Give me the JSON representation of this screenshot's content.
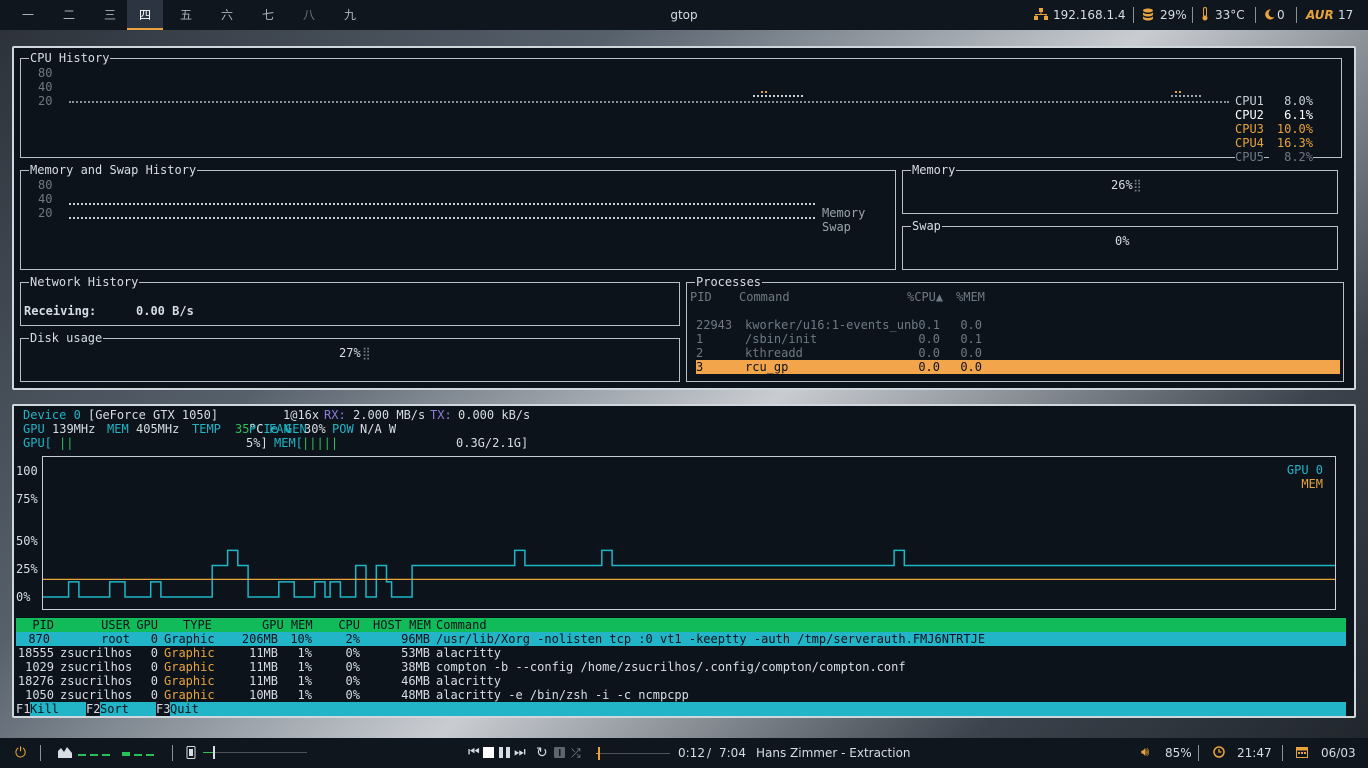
{
  "topbar": {
    "workspaces": [
      "一",
      "二",
      "三",
      "四",
      "五",
      "六",
      "七",
      "八",
      "九"
    ],
    "active_workspace": 3,
    "window_title": "gtop",
    "ip": "192.168.1.4",
    "disk": "29%",
    "temp": "33°C",
    "moon_count": "0",
    "aur_label": "AUR",
    "aur_count": "17"
  },
  "cpu": {
    "title": "CPU History",
    "ticks": [
      "80",
      "40",
      "20"
    ],
    "legend": [
      {
        "name": "CPU1",
        "value": "8.0%",
        "color": "#c9ced3"
      },
      {
        "name": "CPU2",
        "value": "6.1%",
        "color": "#ffffff"
      },
      {
        "name": "CPU3",
        "value": "10.0%",
        "color": "#e8a33d"
      },
      {
        "name": "CPU4",
        "value": "16.3%",
        "color": "#e8a33d"
      },
      {
        "name": "CPU5",
        "value": "8.2%",
        "color": "#6f7983"
      }
    ]
  },
  "memswap": {
    "title": "Memory and Swap History",
    "ticks": [
      "80",
      "40",
      "20"
    ],
    "legend": [
      "Memory",
      "Swap"
    ]
  },
  "memory": {
    "title": "Memory",
    "value": "26%"
  },
  "swap": {
    "title": "Swap",
    "value": "0%"
  },
  "network": {
    "title": "Network History",
    "label": "Receiving:",
    "value": "0.00 B/s"
  },
  "disk": {
    "title": "Disk usage",
    "value": "27%"
  },
  "processes": {
    "title": "Processes",
    "headers": {
      "pid": "PID",
      "command": "Command",
      "cpu": "%CPU▲",
      "mem": "%MEM"
    },
    "rows": [
      {
        "pid": "22943",
        "command": "kworker/u16:1-events_unb",
        "cpu": "0.1",
        "mem": "0.0"
      },
      {
        "pid": "1",
        "command": "/sbin/init",
        "cpu": "0.0",
        "mem": "0.1"
      },
      {
        "pid": "2",
        "command": "kthreadd",
        "cpu": "0.0",
        "mem": "0.0"
      },
      {
        "pid": "3",
        "command": "rcu_gp",
        "cpu": "0.0",
        "mem": "0.0"
      }
    ],
    "selected_index": 3
  },
  "nvtop": {
    "device_label": "Device 0",
    "device_name": "[GeForce GTX 1050]",
    "pcie_label": "PCIe GEN",
    "pcie_value": "1@16x",
    "rx_label": "RX:",
    "rx_value": "2.000 MB/s",
    "tx_label": "TX:",
    "tx_value": "0.000 kB/s",
    "gpu_label": "GPU",
    "gpu_clock": "139MHz",
    "mem_label": "MEM",
    "mem_clock": "405MHz",
    "temp_label": "TEMP",
    "temp_value": "35",
    "temp_unit": "°C",
    "fan_label": "FAN",
    "fan_value": "30%",
    "pow_label": "POW",
    "pow_value": "N/A W",
    "gpu_bar_label": "GPU[",
    "gpu_bar_fill": "||",
    "gpu_bar_value": "5%]",
    "mem_bar_label": "MEM[",
    "mem_bar_fill": "|||||",
    "mem_bar_value": "0.3G/2.1G]",
    "gpu_util_fraction": 0.05,
    "mem_used_fraction": 0.14
  },
  "chart_data": {
    "type": "line",
    "y_ticks": [
      "100",
      "75%",
      "50%",
      "25%",
      "0%"
    ],
    "ylim": [
      0,
      100
    ],
    "legend_position": "top-right",
    "series": [
      {
        "name": "GPU 0",
        "color": "#1fb6c8",
        "values": [
          0,
          0,
          0,
          0,
          0,
          12,
          12,
          0,
          0,
          0,
          0,
          0,
          0,
          12,
          12,
          12,
          0,
          0,
          0,
          0,
          0,
          12,
          12,
          0,
          0,
          0,
          0,
          0,
          0,
          0,
          0,
          0,
          0,
          25,
          25,
          25,
          37,
          37,
          25,
          25,
          0,
          0,
          0,
          0,
          0,
          0,
          12,
          12,
          12,
          0,
          0,
          0,
          0,
          12,
          12,
          0,
          12,
          12,
          0,
          0,
          0,
          25,
          25,
          0,
          0,
          25,
          25,
          12,
          0,
          0,
          0,
          0,
          25,
          25,
          25,
          25,
          25,
          25,
          25,
          25,
          25,
          25,
          25,
          25,
          25,
          25,
          25,
          25,
          25,
          25,
          25,
          25,
          37,
          37,
          25,
          25,
          25,
          25,
          25,
          25,
          25,
          25,
          25,
          25,
          25,
          25,
          25,
          25,
          25,
          37,
          37,
          25,
          25,
          25,
          25,
          25,
          25,
          25,
          25,
          25,
          25,
          25,
          25,
          25,
          25,
          25,
          25,
          25,
          25,
          25,
          25,
          25,
          25,
          25,
          25,
          25,
          25,
          25,
          25,
          25,
          25,
          25,
          25,
          25,
          25,
          25,
          25,
          25,
          25,
          25,
          25,
          25,
          25,
          25,
          25,
          25,
          25,
          25,
          25,
          25,
          25,
          25,
          25,
          25,
          25,
          25,
          37,
          37,
          25,
          25,
          25,
          25,
          25,
          25,
          25,
          25,
          25,
          25,
          25,
          25,
          25,
          25,
          25,
          25,
          25,
          25,
          25,
          25,
          25,
          25,
          25,
          25,
          25,
          25,
          25,
          25,
          25,
          25,
          25,
          25,
          25,
          25,
          25,
          25,
          25,
          25,
          25,
          25,
          25,
          25,
          25,
          25,
          25,
          25,
          25,
          25,
          25,
          25,
          25,
          25,
          25,
          25,
          25,
          25,
          25,
          25,
          25,
          25,
          25,
          25,
          25,
          25,
          25,
          25,
          25,
          25,
          25,
          25,
          25,
          25,
          25,
          25,
          25,
          25,
          25,
          25,
          25,
          25,
          25,
          25,
          25,
          25
        ]
      },
      {
        "name": "MEM",
        "color": "#e8a33d",
        "values": [
          14
        ]
      }
    ]
  },
  "gpu_processes": {
    "headers": {
      "pid": "PID",
      "user": "USER",
      "gpu": "GPU",
      "type": "TYPE",
      "gpu_mem": "GPU MEM",
      "cpu": "CPU",
      "host_mem": "HOST MEM",
      "command": "Command"
    },
    "rows": [
      {
        "pid": "870",
        "user": "root",
        "gpu": "0",
        "type": "Graphic",
        "gpu_mem": "206MB",
        "gpu_mem_pct": "10%",
        "cpu": "2%",
        "host_mem": "96MB",
        "command": "/usr/lib/Xorg -nolisten tcp :0 vt1 -keeptty -auth /tmp/serverauth.FMJ6NTRTJE"
      },
      {
        "pid": "18555",
        "user": "zsucrilhos",
        "gpu": "0",
        "type": "Graphic",
        "gpu_mem": "11MB",
        "gpu_mem_pct": "1%",
        "cpu": "0%",
        "host_mem": "53MB",
        "command": "alacritty"
      },
      {
        "pid": "1029",
        "user": "zsucrilhos",
        "gpu": "0",
        "type": "Graphic",
        "gpu_mem": "11MB",
        "gpu_mem_pct": "1%",
        "cpu": "0%",
        "host_mem": "38MB",
        "command": "compton -b --config /home/zsucrilhos/.config/compton/compton.conf"
      },
      {
        "pid": "18276",
        "user": "zsucrilhos",
        "gpu": "0",
        "type": "Graphic",
        "gpu_mem": "11MB",
        "gpu_mem_pct": "1%",
        "cpu": "0%",
        "host_mem": "46MB",
        "command": "alacritty"
      },
      {
        "pid": "1050",
        "user": "zsucrilhos",
        "gpu": "0",
        "type": "Graphic",
        "gpu_mem": "10MB",
        "gpu_mem_pct": "1%",
        "cpu": "0%",
        "host_mem": "48MB",
        "command": "alacritty -e /bin/zsh -i -c ncmpcpp"
      }
    ],
    "selected_index": 0
  },
  "fkeys": [
    {
      "key": "F1",
      "label": "Kill"
    },
    {
      "key": "F2",
      "label": "Sort"
    },
    {
      "key": "F3",
      "label": "Quit"
    }
  ],
  "bottombar": {
    "time_elapsed": "0:12",
    "time_sep": "/",
    "time_total": "7:04",
    "track": "Hans Zimmer - Extraction",
    "volume": "85%",
    "clock": "21:47",
    "date": "06/03",
    "player_progress": 0.03,
    "brightness_level": 0.4
  }
}
